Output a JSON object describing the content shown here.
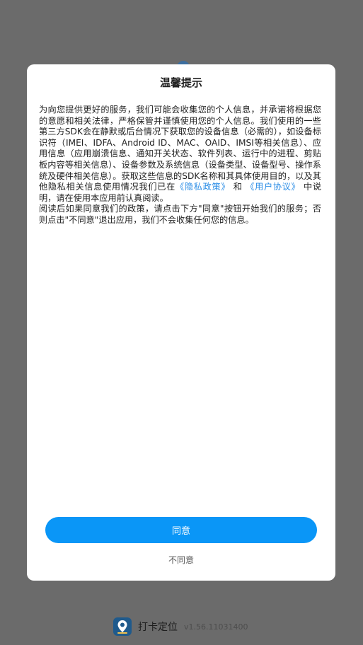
{
  "dialog": {
    "title": "温馨提示",
    "body_before_privacy": "为向您提供更好的服务，我们可能会收集您的个人信息，并承诺将根据您的意愿和相关法律，严格保管并谨慎使用您的个人信息。我们使用的一些第三方SDK会在静默或后台情况下获取您的设备信息（必需的），如设备标识符（IMEI、IDFA、Android ID、MAC、OAID、IMSI等相关信息）、应用信息（应用崩溃信息、通知开关状态、软件列表、运行中的进程、剪贴板内容等相关信息）、设备参数及系统信息（设备类型、设备型号、操作系统及硬件相关信息）。获取这些信息的SDK名称和其具体使用目的，以及其他隐私相关信息使用情况我们已在",
    "privacy_link": "《隐私政策》",
    "and_text": "和",
    "terms_link": "《用户协议》",
    "body_after_terms": "中说明，请在使用本应用前认真阅读。",
    "body_second": "阅读后如果同意我们的政策，请点击下方\"同意\"按钮开始我们的服务；否则点击\"不同意\"退出应用，我们不会收集任何您的信息。",
    "agree_label": "同意",
    "disagree_label": "不同意"
  },
  "footer": {
    "app_name": "打卡定位",
    "version": "v1.56.11031400"
  },
  "colors": {
    "overlay": "#6b6b6b",
    "accent": "#0a96f7",
    "link": "#2b8de6"
  }
}
